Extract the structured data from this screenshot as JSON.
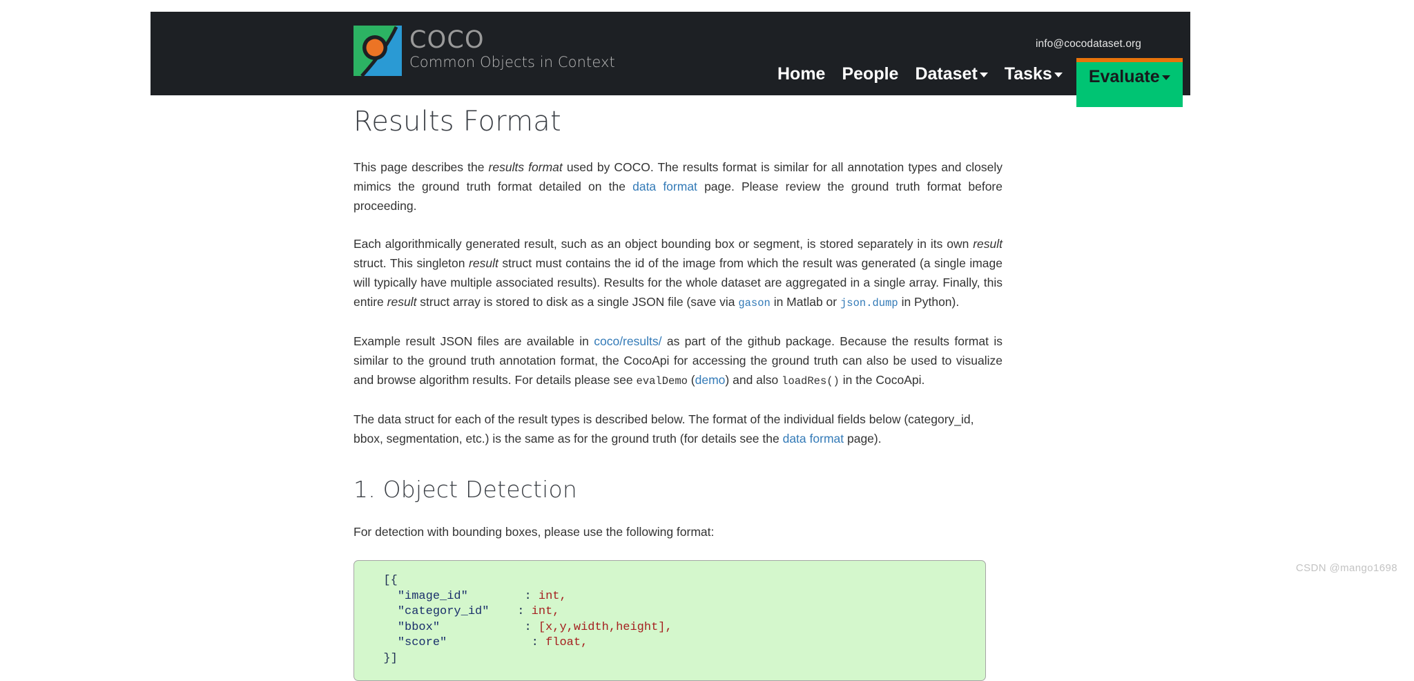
{
  "site": {
    "logo_title": "COCO",
    "logo_subtitle": "Common Objects in Context",
    "email": "info@cocodataset.org",
    "colors": {
      "navbar_bg": "#1d2024",
      "accent_green": "#00c473",
      "accent_orange": "#e8730b",
      "link_blue": "#337ab7",
      "code_bg": "#d4f7cc",
      "code_string": "#1a2f6b",
      "code_value": "#a52020"
    }
  },
  "nav": {
    "items": [
      {
        "label": "Home",
        "has_caret": false,
        "active": false
      },
      {
        "label": "People",
        "has_caret": false,
        "active": false
      },
      {
        "label": "Dataset",
        "has_caret": true,
        "active": false
      },
      {
        "label": "Tasks",
        "has_caret": true,
        "active": false
      },
      {
        "label": "Evaluate",
        "has_caret": true,
        "active": true
      }
    ]
  },
  "main": {
    "title": "Results Format",
    "p1": {
      "a": "This page describes the ",
      "i1": "results format",
      "b": " used by COCO. The results format is similar for all annotation types and closely mimics the ground truth format detailed on the ",
      "link": "data format",
      "c": " page. Please review the ground truth format before proceeding."
    },
    "p2": {
      "a": "Each algorithmically generated result, such as an object bounding box or segment, is stored separately in its own ",
      "i1": "result",
      "b": " struct. This singleton ",
      "i2": "result",
      "c": " struct must contains the id of the image from which the result was generated (a single image will typically have multiple associated results). Results for the whole dataset are aggregated in a single array. Finally, this entire ",
      "i3": "result",
      "d": " struct array is stored to disk as a single JSON file (save via ",
      "code1": "gason",
      "e": " in Matlab or ",
      "code2": "json.dump",
      "f": " in Python)."
    },
    "p3": {
      "a": "Example result JSON files are available in ",
      "link1": "coco/results/",
      "b": " as part of the github package. Because the results format is similar to the ground truth annotation format, the CocoApi for accessing the ground truth can also be used to visualize and browse algorithm results. For details please see ",
      "code1": "evalDemo",
      "c": " (",
      "link2": "demo",
      "d": ") and also ",
      "code2": "loadRes()",
      "e": " in the CocoApi."
    },
    "p4": {
      "a": "The data struct for each of the result types is described below. The format of the individual fields below (category_id, bbox, segmentation, etc.) is the same as for the ground truth (for details see the ",
      "link": "data format",
      "b": " page)."
    },
    "section1": {
      "title": "1. Object Detection",
      "intro": "For detection with bounding boxes, please use the following format:",
      "code_lines": [
        {
          "indent": 0,
          "parts": [
            {
              "t": "[{",
              "c": "p"
            }
          ]
        },
        {
          "indent": 1,
          "parts": [
            {
              "t": "\"image_id\"",
              "c": "s"
            },
            {
              "t": "\t\t: ",
              "c": "p"
            },
            {
              "t": "int,",
              "c": "v"
            }
          ]
        },
        {
          "indent": 1,
          "parts": [
            {
              "t": "\"category_id\"",
              "c": "s"
            },
            {
              "t": "\t: ",
              "c": "p"
            },
            {
              "t": "int,",
              "c": "v"
            }
          ]
        },
        {
          "indent": 1,
          "parts": [
            {
              "t": "\"bbox\"",
              "c": "s"
            },
            {
              "t": "\t\t\t: ",
              "c": "p"
            },
            {
              "t": "[x,y,width,height],",
              "c": "v"
            }
          ]
        },
        {
          "indent": 1,
          "parts": [
            {
              "t": "\"score\"",
              "c": "s"
            },
            {
              "t": "\t\t\t: ",
              "c": "p"
            },
            {
              "t": "float,",
              "c": "v"
            }
          ]
        },
        {
          "indent": 0,
          "parts": [
            {
              "t": "}]",
              "c": "p"
            }
          ]
        }
      ],
      "code_text": "  [{\n    \"image_id\"        : int,\n    \"category_id\"     : int,\n    \"bbox\"            : [x,y,width,height],\n    \"score\"           : float,\n  }]"
    }
  },
  "watermark": "CSDN @mango1698"
}
